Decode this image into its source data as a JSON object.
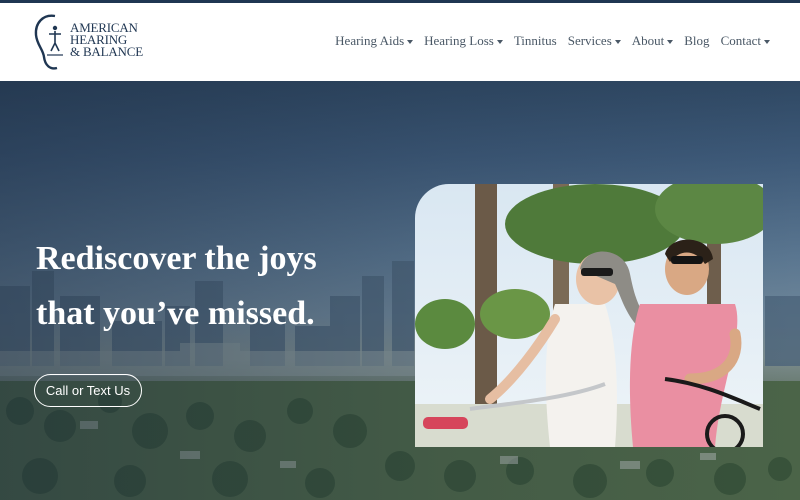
{
  "brand": {
    "line1": "AMERICAN",
    "line2": "HEARING",
    "line3": "& BALANCE"
  },
  "nav": {
    "items": [
      {
        "label": "Hearing Aids",
        "dropdown": true
      },
      {
        "label": "Hearing Loss",
        "dropdown": true
      },
      {
        "label": "Tinnitus",
        "dropdown": false
      },
      {
        "label": "Services",
        "dropdown": true
      },
      {
        "label": "About",
        "dropdown": true
      },
      {
        "label": "Blog",
        "dropdown": false
      },
      {
        "label": "Contact",
        "dropdown": true
      }
    ]
  },
  "hero": {
    "headline_line1": "Rediscover the joys",
    "headline_line2": "that you’ve missed.",
    "cta_label": "Call or Text Us"
  },
  "colors": {
    "brand_navy": "#1f3652",
    "nav_text": "#4a5866",
    "hero_text": "#ffffff"
  },
  "icons": {
    "logo": "ear-with-figure-icon",
    "dropdown": "chevron-down-icon"
  }
}
